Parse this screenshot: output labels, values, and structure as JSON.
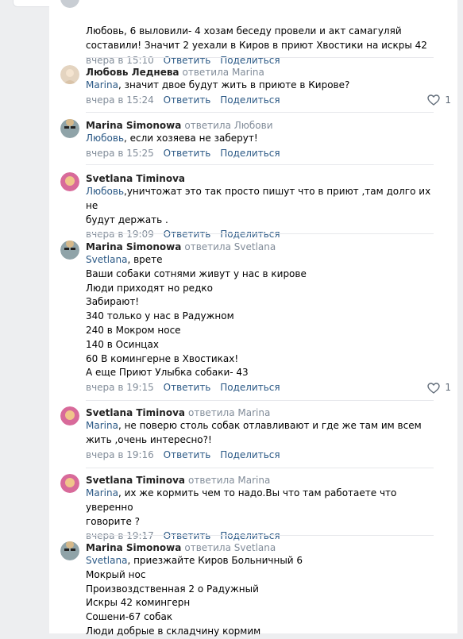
{
  "comments": [
    {
      "lines": [
        [
          {
            "m": false,
            "t": "Любовь, 6 выловили- 4 хозам беседу провели и акт самагуляй"
          }
        ],
        [
          {
            "m": false,
            "t": "составили! Значит 2 уехали в Киров в приют Хвостики на искры 42"
          }
        ]
      ],
      "time": "вчера в 15:10",
      "reply": "Ответить",
      "share": "Поделиться"
    },
    {
      "author": "Любовь Леднева",
      "replied": "ответила Marina",
      "lines": [
        [
          {
            "m": true,
            "t": "Marina"
          },
          {
            "m": false,
            "t": ", значит двое будут жить в приюте в Кирове?"
          }
        ]
      ],
      "time": "вчера в 15:24",
      "reply": "Ответить",
      "share": "Поделиться",
      "likes": "1"
    },
    {
      "author": "Marina Simonowa",
      "replied": "ответила Любови",
      "lines": [
        [
          {
            "m": true,
            "t": "Любовь"
          },
          {
            "m": false,
            "t": ", если хозяева не заберут!"
          }
        ]
      ],
      "time": "вчера в 15:25",
      "reply": "Ответить",
      "share": "Поделиться"
    },
    {
      "author": "Svetlana Timinova",
      "replied": "",
      "lines": [
        [
          {
            "m": true,
            "t": "Любовь"
          },
          {
            "m": false,
            "t": ",уничтожат это так просто пишут что в приют ,там долго их не"
          }
        ],
        [
          {
            "m": false,
            "t": "будут держать ."
          }
        ]
      ],
      "time": "вчера в 19:09",
      "reply": "Ответить",
      "share": "Поделиться"
    },
    {
      "author": "Marina Simonowa",
      "replied": "ответила Svetlana",
      "lines": [
        [
          {
            "m": true,
            "t": "Svetlana"
          },
          {
            "m": false,
            "t": ", врете"
          }
        ],
        [
          {
            "m": false,
            "t": "Ваши собаки сотнями живут у нас в кирове"
          }
        ],
        [
          {
            "m": false,
            "t": "Люди приходят но редко"
          }
        ],
        [
          {
            "m": false,
            "t": "Забирают!"
          }
        ],
        [
          {
            "m": false,
            "t": "340 только у нас в Радужном"
          }
        ],
        [
          {
            "m": false,
            "t": "240 в Мокром носе"
          }
        ],
        [
          {
            "m": false,
            "t": "140 в Осинцах"
          }
        ],
        [
          {
            "m": false,
            "t": "60 В комингерне в Хвостиках!"
          }
        ],
        [
          {
            "m": false,
            "t": "А еще Приют Улыбка собаки- 43"
          }
        ]
      ],
      "time": "вчера в 19:15",
      "reply": "Ответить",
      "share": "Поделиться",
      "likes": "1"
    },
    {
      "author": "Svetlana Timinova",
      "replied": "ответила Marina",
      "lines": [
        [
          {
            "m": true,
            "t": "Marina"
          },
          {
            "m": false,
            "t": ", не поверю столь собак отлавливают и где же там им всем"
          }
        ],
        [
          {
            "m": false,
            "t": "жить ,очень интересно?!"
          }
        ]
      ],
      "time": "вчера в 19:16",
      "reply": "Ответить",
      "share": "Поделиться"
    },
    {
      "author": "Svetlana Timinova",
      "replied": "ответила Marina",
      "lines": [
        [
          {
            "m": true,
            "t": "Marina"
          },
          {
            "m": false,
            "t": ", их же кормить чем то надо.Вы что там работаете что уверенно"
          }
        ],
        [
          {
            "m": false,
            "t": "говорите ?"
          }
        ]
      ],
      "time": "вчера в 19:17",
      "reply": "Ответить",
      "share": "Поделиться"
    },
    {
      "author": "Marina Simonowa",
      "replied": "ответила Svetlana",
      "lines": [
        [
          {
            "m": true,
            "t": "Svetlana"
          },
          {
            "m": false,
            "t": ", приезжайте Киров Больничный 6"
          }
        ],
        [
          {
            "m": false,
            "t": "Мокрый нос"
          }
        ],
        [
          {
            "m": false,
            "t": "Произвоздственная 2 о Радужный"
          }
        ],
        [
          {
            "m": false,
            "t": "Искры 42 комингерн"
          }
        ],
        [
          {
            "m": false,
            "t": "Сошени-67 собак"
          }
        ],
        [
          {
            "m": false,
            "t": "Люди добрые в складчину кормим"
          }
        ]
      ]
    }
  ],
  "colors": {
    "link": "#2a5885",
    "muted": "#818c99",
    "page_bg": "#edeef0"
  }
}
